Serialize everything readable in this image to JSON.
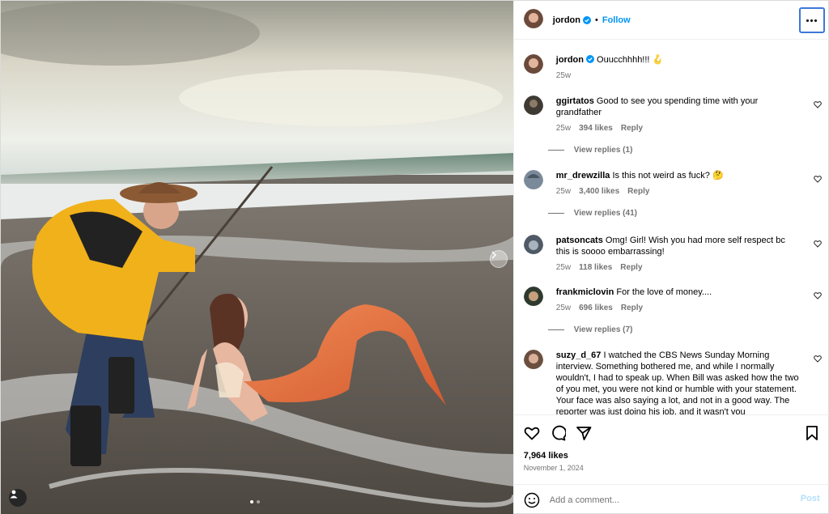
{
  "post": {
    "username": "jordon",
    "follow_label": "Follow",
    "caption": "Ouucchhhh!!! 🪝",
    "caption_age": "25w",
    "likes": "7,964 likes",
    "date": "November 1, 2024"
  },
  "comments": [
    {
      "user": "ggirtatos",
      "text": "Good to see you spending time with your grandfather",
      "age": "25w",
      "likes": "394 likes",
      "reply": "Reply",
      "view_replies": "View replies (1)"
    },
    {
      "user": "mr_drewzilla",
      "text": "Is this not weird as fuck? 🤔",
      "age": "25w",
      "likes": "3,400 likes",
      "reply": "Reply",
      "view_replies": "View replies (41)"
    },
    {
      "user": "patsoncats",
      "text": "Omg! Girl! Wish you had more self respect bc this is soooo embarrassing!",
      "age": "25w",
      "likes": "118 likes",
      "reply": "Reply",
      "view_replies": ""
    },
    {
      "user": "frankmiclovin",
      "text": "For the love of money....",
      "age": "25w",
      "likes": "696 likes",
      "reply": "Reply",
      "view_replies": "View replies (7)"
    },
    {
      "user": "suzy_d_67",
      "text": "I watched the CBS News Sunday Morning interview. Something bothered me, and while I normally wouldn't, I had to speak up. When Bill was asked how the two of you met, you were not kind or humble with your statement. Your face was also saying a lot, and not in a good way. The reporter was just doing his job, and it wasn't you",
      "age": "",
      "likes": "",
      "reply": "",
      "view_replies": ""
    }
  ],
  "add_comment": {
    "placeholder": "Add a comment...",
    "post_label": "Post"
  },
  "icons": {
    "more": "more-options-icon",
    "heart": "heart-icon",
    "comment": "comment-icon",
    "share": "share-icon",
    "save": "bookmark-icon",
    "emoji": "emoji-icon",
    "verified": "verified-badge-icon",
    "next": "chevron-right-icon",
    "tag": "user-tag-icon"
  },
  "colors": {
    "accent": "#0095f6",
    "verified": "#0095f6",
    "focus_ring": "#3c78d8",
    "muted": "#737373"
  }
}
